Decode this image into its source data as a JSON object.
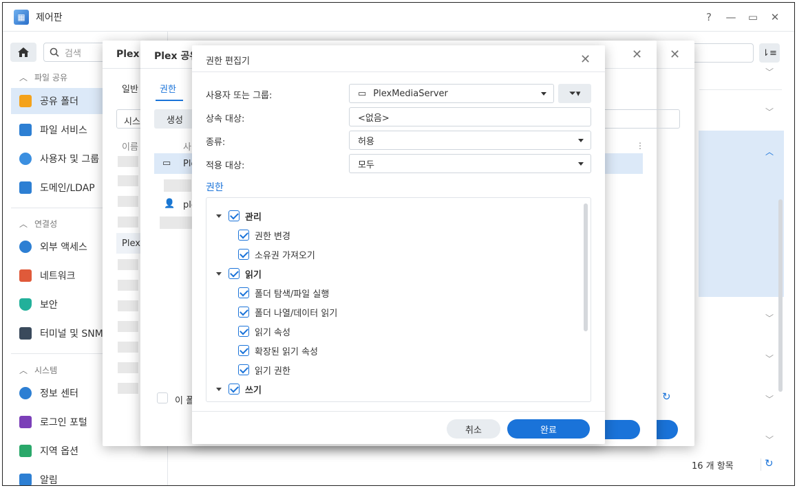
{
  "window": {
    "title": "제어판"
  },
  "sidebar": {
    "search_placeholder": "검색",
    "sections": [
      {
        "label": "파일 공유"
      },
      {
        "label": "연결성"
      },
      {
        "label": "시스템"
      }
    ],
    "items": [
      {
        "label": "공유 폴더",
        "icon": "folder-icon"
      },
      {
        "label": "파일 서비스",
        "icon": "file-services-icon"
      },
      {
        "label": "사용자 및 그룹",
        "icon": "users-icon"
      },
      {
        "label": "도메인/LDAP",
        "icon": "domain-icon"
      },
      {
        "label": "외부 액세스",
        "icon": "external-access-icon"
      },
      {
        "label": "네트워크",
        "icon": "network-icon"
      },
      {
        "label": "보안",
        "icon": "shield-icon"
      },
      {
        "label": "터미널 및 SNMP",
        "icon": "terminal-icon"
      },
      {
        "label": "정보 센터",
        "icon": "info-icon"
      },
      {
        "label": "로그인 포털",
        "icon": "login-portal-icon"
      },
      {
        "label": "지역 옵션",
        "icon": "regional-icon"
      },
      {
        "label": "알림",
        "icon": "notification-icon"
      }
    ]
  },
  "main": {
    "item_count": "16 개 항목"
  },
  "dialog_back": {
    "title": "Plex",
    "tab": "일반",
    "field_prefix": "시스",
    "col_header": "이름",
    "row_label": "Plex"
  },
  "dialog_mid": {
    "title": "Plex 공유",
    "tab": "권한",
    "create_button": "생성",
    "col_header": "사",
    "row1": "Ple",
    "row2": "ple",
    "footer_checkbox": "이 폴"
  },
  "editor": {
    "title": "권한 편집기",
    "user_group_label": "사용자 또는 그룹:",
    "user_group_value": "PlexMediaServer",
    "inherit_label": "상속 대상:",
    "inherit_value": "<없음>",
    "type_label": "종류:",
    "type_value": "허용",
    "apply_label": "적용 대상:",
    "apply_value": "모두",
    "permissions_heading": "권한",
    "groups": [
      {
        "label": "관리",
        "items": [
          "권한 변경",
          "소유권 가져오기"
        ]
      },
      {
        "label": "읽기",
        "items": [
          "폴더 탐색/파일 실행",
          "폴더 나열/데이터 읽기",
          "읽기 속성",
          "확장된 읽기 속성",
          "읽기 권한"
        ]
      },
      {
        "label": "쓰기",
        "items": []
      }
    ],
    "cancel_button": "취소",
    "done_button": "완료"
  },
  "colors": {
    "accent": "#1a73d9",
    "selected_bg": "#dce9f8"
  }
}
